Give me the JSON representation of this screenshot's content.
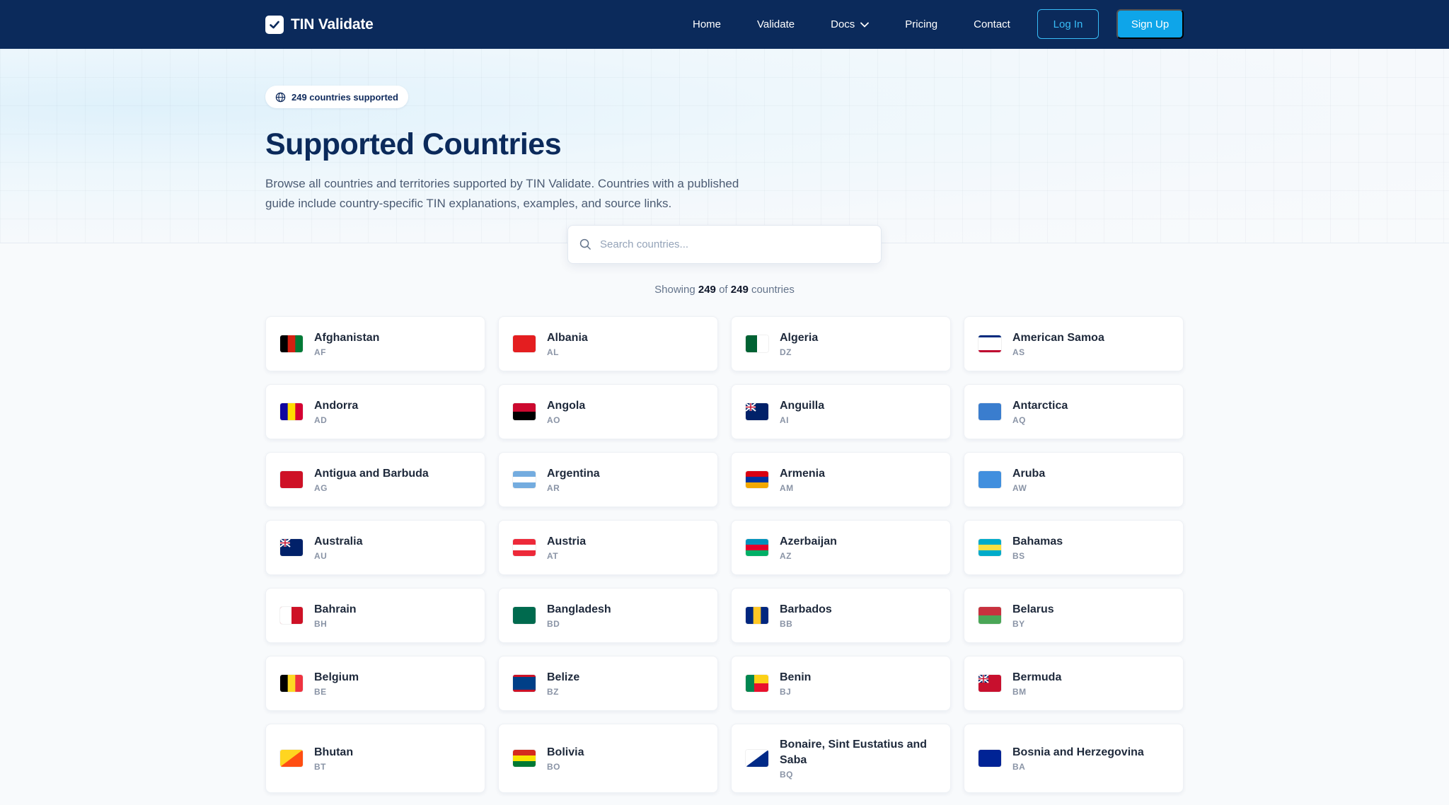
{
  "nav": {
    "brand": "TIN Validate",
    "links": [
      "Home",
      "Validate",
      "Docs",
      "Pricing",
      "Contact"
    ],
    "login": "Log In",
    "signup": "Sign Up"
  },
  "hero": {
    "badge": "249 countries supported",
    "title": "Supported Countries",
    "description": "Browse all countries and territories supported by TIN Validate. Countries with a published guide include country-specific TIN explanations, examples, and source links."
  },
  "search": {
    "placeholder": "Search countries..."
  },
  "summary": {
    "prefix": "Showing",
    "shown": "249",
    "of": "of",
    "total": "249",
    "suffix": "countries"
  },
  "colors": {
    "navbar": "#0b2a5b",
    "accent": "#0ea5e9",
    "accent_outline": "#38bdf8"
  },
  "countries": [
    {
      "name": "Afghanistan",
      "code": "AF",
      "flag": "tricolor-v:#000000,#d32011,#007a36"
    },
    {
      "name": "Albania",
      "code": "AL",
      "flag": "solid:#e41e20"
    },
    {
      "name": "Algeria",
      "code": "DZ",
      "flag": "bicolor-v:#006233,#ffffff"
    },
    {
      "name": "American Samoa",
      "code": "AS",
      "flag": "tri-stripe:#002b7f,#ffffff,#bf0a30"
    },
    {
      "name": "Andorra",
      "code": "AD",
      "flag": "tricolor-v:#10069f,#fedd00,#d50032"
    },
    {
      "name": "Angola",
      "code": "AO",
      "flag": "bicolor-h:#cc092f,#000000"
    },
    {
      "name": "Anguilla",
      "code": "AI",
      "flag": "ensign:#012169"
    },
    {
      "name": "Antarctica",
      "code": "AQ",
      "flag": "solid:#3a7dce"
    },
    {
      "name": "Antigua and Barbuda",
      "code": "AG",
      "flag": "solid:#ce1126"
    },
    {
      "name": "Argentina",
      "code": "AR",
      "flag": "tricolor-h:#74acdf,#ffffff,#74acdf"
    },
    {
      "name": "Armenia",
      "code": "AM",
      "flag": "tricolor-h:#d90012,#0033a0,#f2a800"
    },
    {
      "name": "Aruba",
      "code": "AW",
      "flag": "solid:#418fde"
    },
    {
      "name": "Australia",
      "code": "AU",
      "flag": "ensign:#012169"
    },
    {
      "name": "Austria",
      "code": "AT",
      "flag": "tricolor-h:#ed2939,#ffffff,#ed2939"
    },
    {
      "name": "Azerbaijan",
      "code": "AZ",
      "flag": "tricolor-h:#0092bc,#e4002b,#00af66"
    },
    {
      "name": "Bahamas",
      "code": "BS",
      "flag": "tricolor-h:#00abc9,#fae042,#00abc9"
    },
    {
      "name": "Bahrain",
      "code": "BH",
      "flag": "bicolor-v:#ffffff,#ce1126"
    },
    {
      "name": "Bangladesh",
      "code": "BD",
      "flag": "solid:#006a4e"
    },
    {
      "name": "Barbados",
      "code": "BB",
      "flag": "tricolor-v:#00267f,#ffc726,#00267f"
    },
    {
      "name": "Belarus",
      "code": "BY",
      "flag": "bicolor-h:#c8313e,#4aa657"
    },
    {
      "name": "Belgium",
      "code": "BE",
      "flag": "tricolor-v:#000000,#fdda24,#ef3340"
    },
    {
      "name": "Belize",
      "code": "BZ",
      "flag": "tri-stripe:#ce1126,#003f87,#ce1126"
    },
    {
      "name": "Benin",
      "code": "BJ",
      "flag": "benin:#008751,#fcd116,#e8112d"
    },
    {
      "name": "Bermuda",
      "code": "BM",
      "flag": "ensign:#c8102e"
    },
    {
      "name": "Bhutan",
      "code": "BT",
      "flag": "diag:#ffd520,#ff4e12"
    },
    {
      "name": "Bolivia",
      "code": "BO",
      "flag": "tricolor-h:#d52b1e,#f9e300,#007934"
    },
    {
      "name": "Bonaire, Sint Eustatius and Saba",
      "code": "BQ",
      "flag": "diag:#ffffff,#012a87"
    },
    {
      "name": "Bosnia and Herzegovina",
      "code": "BA",
      "flag": "solid:#002395"
    }
  ]
}
